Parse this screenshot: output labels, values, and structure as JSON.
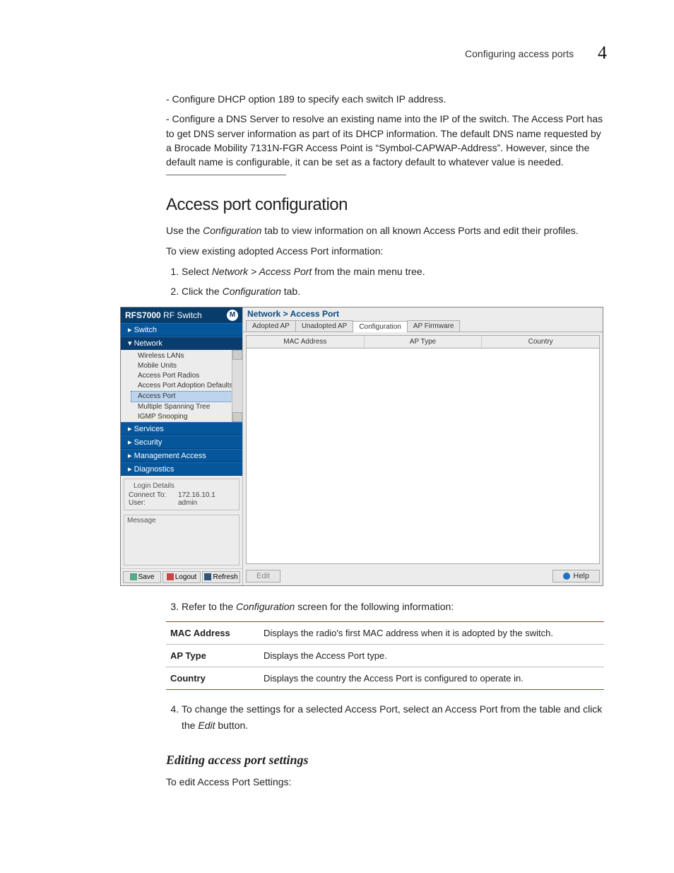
{
  "header": {
    "running": "Configuring access ports",
    "chapter": "4"
  },
  "intro": {
    "p1": "- Configure DHCP option 189 to specify each switch IP address.",
    "p2": "- Configure a DNS Server to resolve an existing name into the IP of the switch. The Access Port has to get DNS server information as part of its DHCP information. The default DNS name requested by a Brocade Mobility 7131N-FGR Access Point is “Symbol-CAPWAP-Address”. However, since the default name is configurable, it can be set as a factory default to whatever value is needed."
  },
  "section": {
    "title": "Access port configuration"
  },
  "para": {
    "use_prefix": "Use the ",
    "use_em": "Configuration",
    "use_suffix": " tab to view information on all known Access Ports and edit their profiles.",
    "view": "To view existing adopted Access Port information:"
  },
  "steps_top": {
    "s1_a": "Select ",
    "s1_em": "Network > Access Port",
    "s1_b": " from the main menu tree.",
    "s2_a": "Click the ",
    "s2_em": "Configuration",
    "s2_b": " tab."
  },
  "shot": {
    "title_a": "RFS7000",
    "title_b": " RF Switch",
    "nav": {
      "switch": "Switch",
      "network": "Network",
      "tree": [
        "Wireless LANs",
        "Mobile Units",
        "Access Port Radios",
        "Access Port Adoption Defaults",
        "Access Port",
        "Multiple Spanning Tree",
        "IGMP Snooping"
      ],
      "tree_selected_index": 4,
      "services": "Services",
      "security": "Security",
      "mgmt": "Management Access",
      "diag": "Diagnostics"
    },
    "login": {
      "legend": "Login Details",
      "connect_label": "Connect To:",
      "connect_val": "172.16.10.1",
      "user_label": "User:",
      "user_val": "admin"
    },
    "message_legend": "Message",
    "left_buttons": {
      "save": "Save",
      "logout": "Logout",
      "refresh": "Refresh"
    },
    "crumb": "Network > Access Port",
    "tabs": [
      "Adopted AP",
      "Unadopted AP",
      "Configuration",
      "AP Firmware"
    ],
    "tabs_active_index": 2,
    "grid_headers": [
      "MAC Address",
      "AP Type",
      "Country"
    ],
    "right_buttons": {
      "edit": "Edit",
      "help": "Help"
    }
  },
  "steps_bottom": {
    "s3_a": "Refer to the ",
    "s3_em": "Configuration",
    "s3_b": " screen for the following information:",
    "s4_a": "To change the settings for a selected Access Port, select an Access Port from the table and click the ",
    "s4_em": "Edit",
    "s4_b": " button."
  },
  "table": {
    "rows": [
      {
        "key": "MAC Address",
        "val": "Displays the radio's first MAC address when it is adopted by the switch."
      },
      {
        "key": "AP Type",
        "val": "Displays the Access Port type."
      },
      {
        "key": "Country",
        "val": "Displays the country the Access Port is configured to operate in."
      }
    ]
  },
  "subsection": {
    "title": "Editing access port settings",
    "lead": "To edit Access Port Settings:"
  }
}
